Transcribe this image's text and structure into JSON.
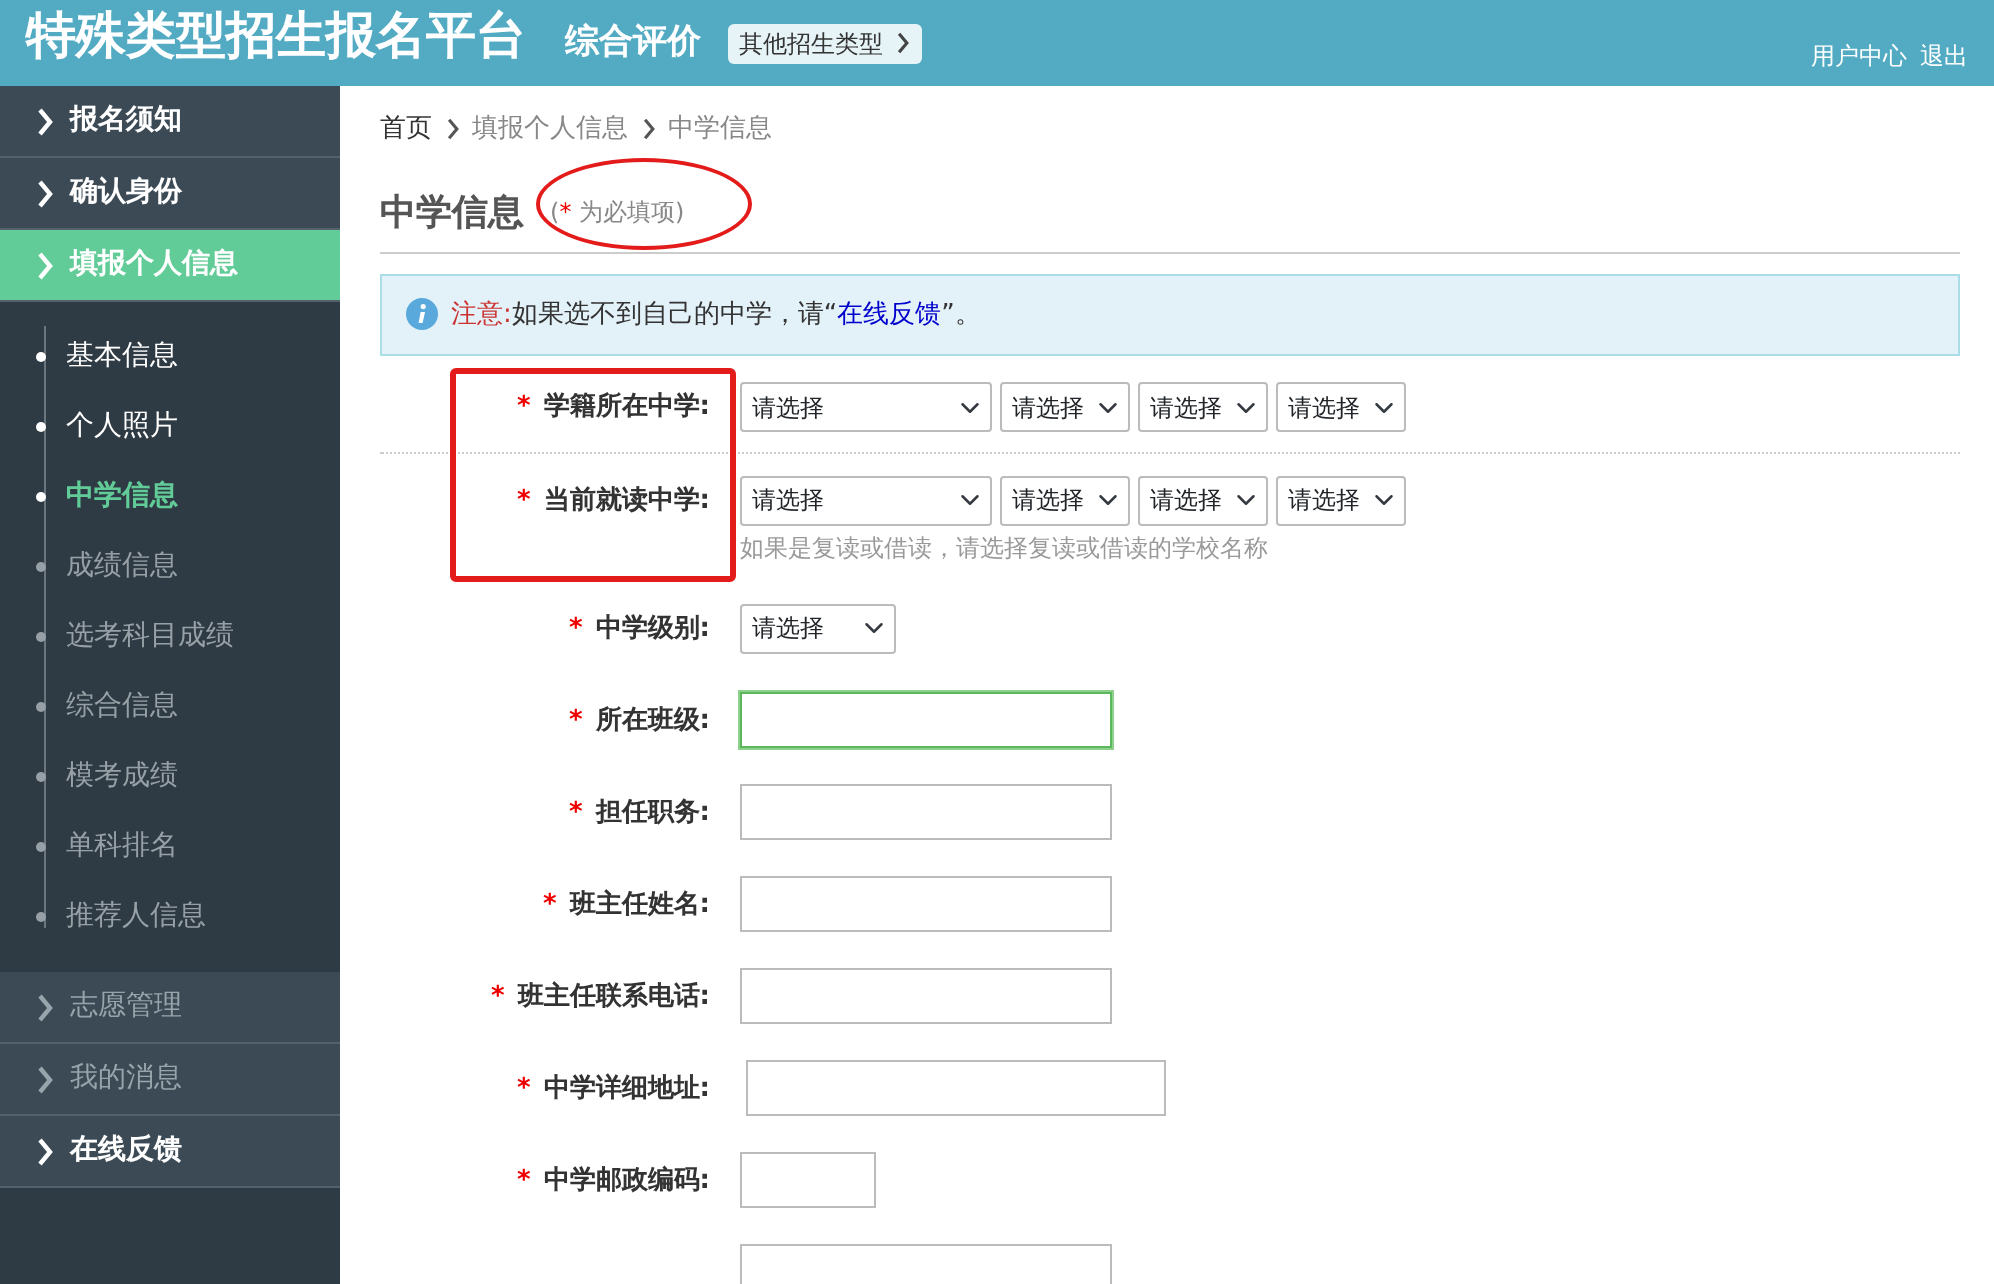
{
  "header": {
    "title": "特殊类型招生报名平台",
    "subtitle": "综合评价",
    "switch_button": "其他招生类型",
    "user_links": [
      "用户中心",
      "退出"
    ]
  },
  "sidebar": {
    "items": [
      {
        "label": "报名须知",
        "disabled": false,
        "selected": false
      },
      {
        "label": "确认身份",
        "disabled": false,
        "selected": false
      },
      {
        "label": "填报个人信息",
        "disabled": false,
        "selected": true,
        "children": [
          {
            "label": "基本信息",
            "disabled": false,
            "selected": false
          },
          {
            "label": "个人照片",
            "disabled": false,
            "selected": false
          },
          {
            "label": "中学信息",
            "disabled": false,
            "selected": true
          },
          {
            "label": "成绩信息",
            "disabled": true,
            "selected": false
          },
          {
            "label": "选考科目成绩",
            "disabled": true,
            "selected": false
          },
          {
            "label": "综合信息",
            "disabled": true,
            "selected": false
          },
          {
            "label": "模考成绩",
            "disabled": true,
            "selected": false
          },
          {
            "label": "单科排名",
            "disabled": true,
            "selected": false
          },
          {
            "label": "推荐人信息",
            "disabled": true,
            "selected": false
          }
        ]
      },
      {
        "label": "志愿管理",
        "disabled": true,
        "selected": false
      },
      {
        "label": "我的消息",
        "disabled": true,
        "selected": false
      },
      {
        "label": "在线反馈",
        "disabled": false,
        "selected": false
      }
    ]
  },
  "breadcrumb": [
    "首页",
    "填报个人信息",
    "中学信息"
  ],
  "page_title": "中学信息",
  "required_note": {
    "open": "(",
    "mark": "*",
    "text": "为必填项)"
  },
  "notice": {
    "label": "注意:",
    "text": "如果选不到自己的中学，请“",
    "link": "在线反馈",
    "after": "”。"
  },
  "fields": [
    {
      "label": "学籍所在中学:",
      "required": true,
      "kind": "schoolselect",
      "selects": [
        "请选择",
        "请选择",
        "请选择",
        "请选择"
      ],
      "focused": false
    },
    {
      "label": "当前就读中学:",
      "required": true,
      "kind": "schoolselect",
      "selects": [
        "请选择",
        "请选择",
        "请选择",
        "请选择"
      ],
      "hint": "如果是复读或借读，请选择复读或借读的学校名称",
      "focused": false
    },
    {
      "label": "中学级别:",
      "required": true,
      "kind": "select",
      "selects": [
        "请选择"
      ],
      "focused": false
    },
    {
      "label": "所在班级:",
      "required": true,
      "kind": "text",
      "focused": true
    },
    {
      "label": "担任职务:",
      "required": true,
      "kind": "text",
      "focused": false
    },
    {
      "label": "班主任姓名:",
      "required": true,
      "kind": "text",
      "focused": false
    },
    {
      "label": "班主任联系电话:",
      "required": true,
      "kind": "text",
      "focused": false
    },
    {
      "label": "中学详细地址:",
      "required": true,
      "kind": "long",
      "focused": false
    },
    {
      "label": "中学邮政编码:",
      "required": true,
      "kind": "short",
      "focused": false
    },
    {
      "required": false,
      "kind": "text",
      "focused": false
    }
  ]
}
